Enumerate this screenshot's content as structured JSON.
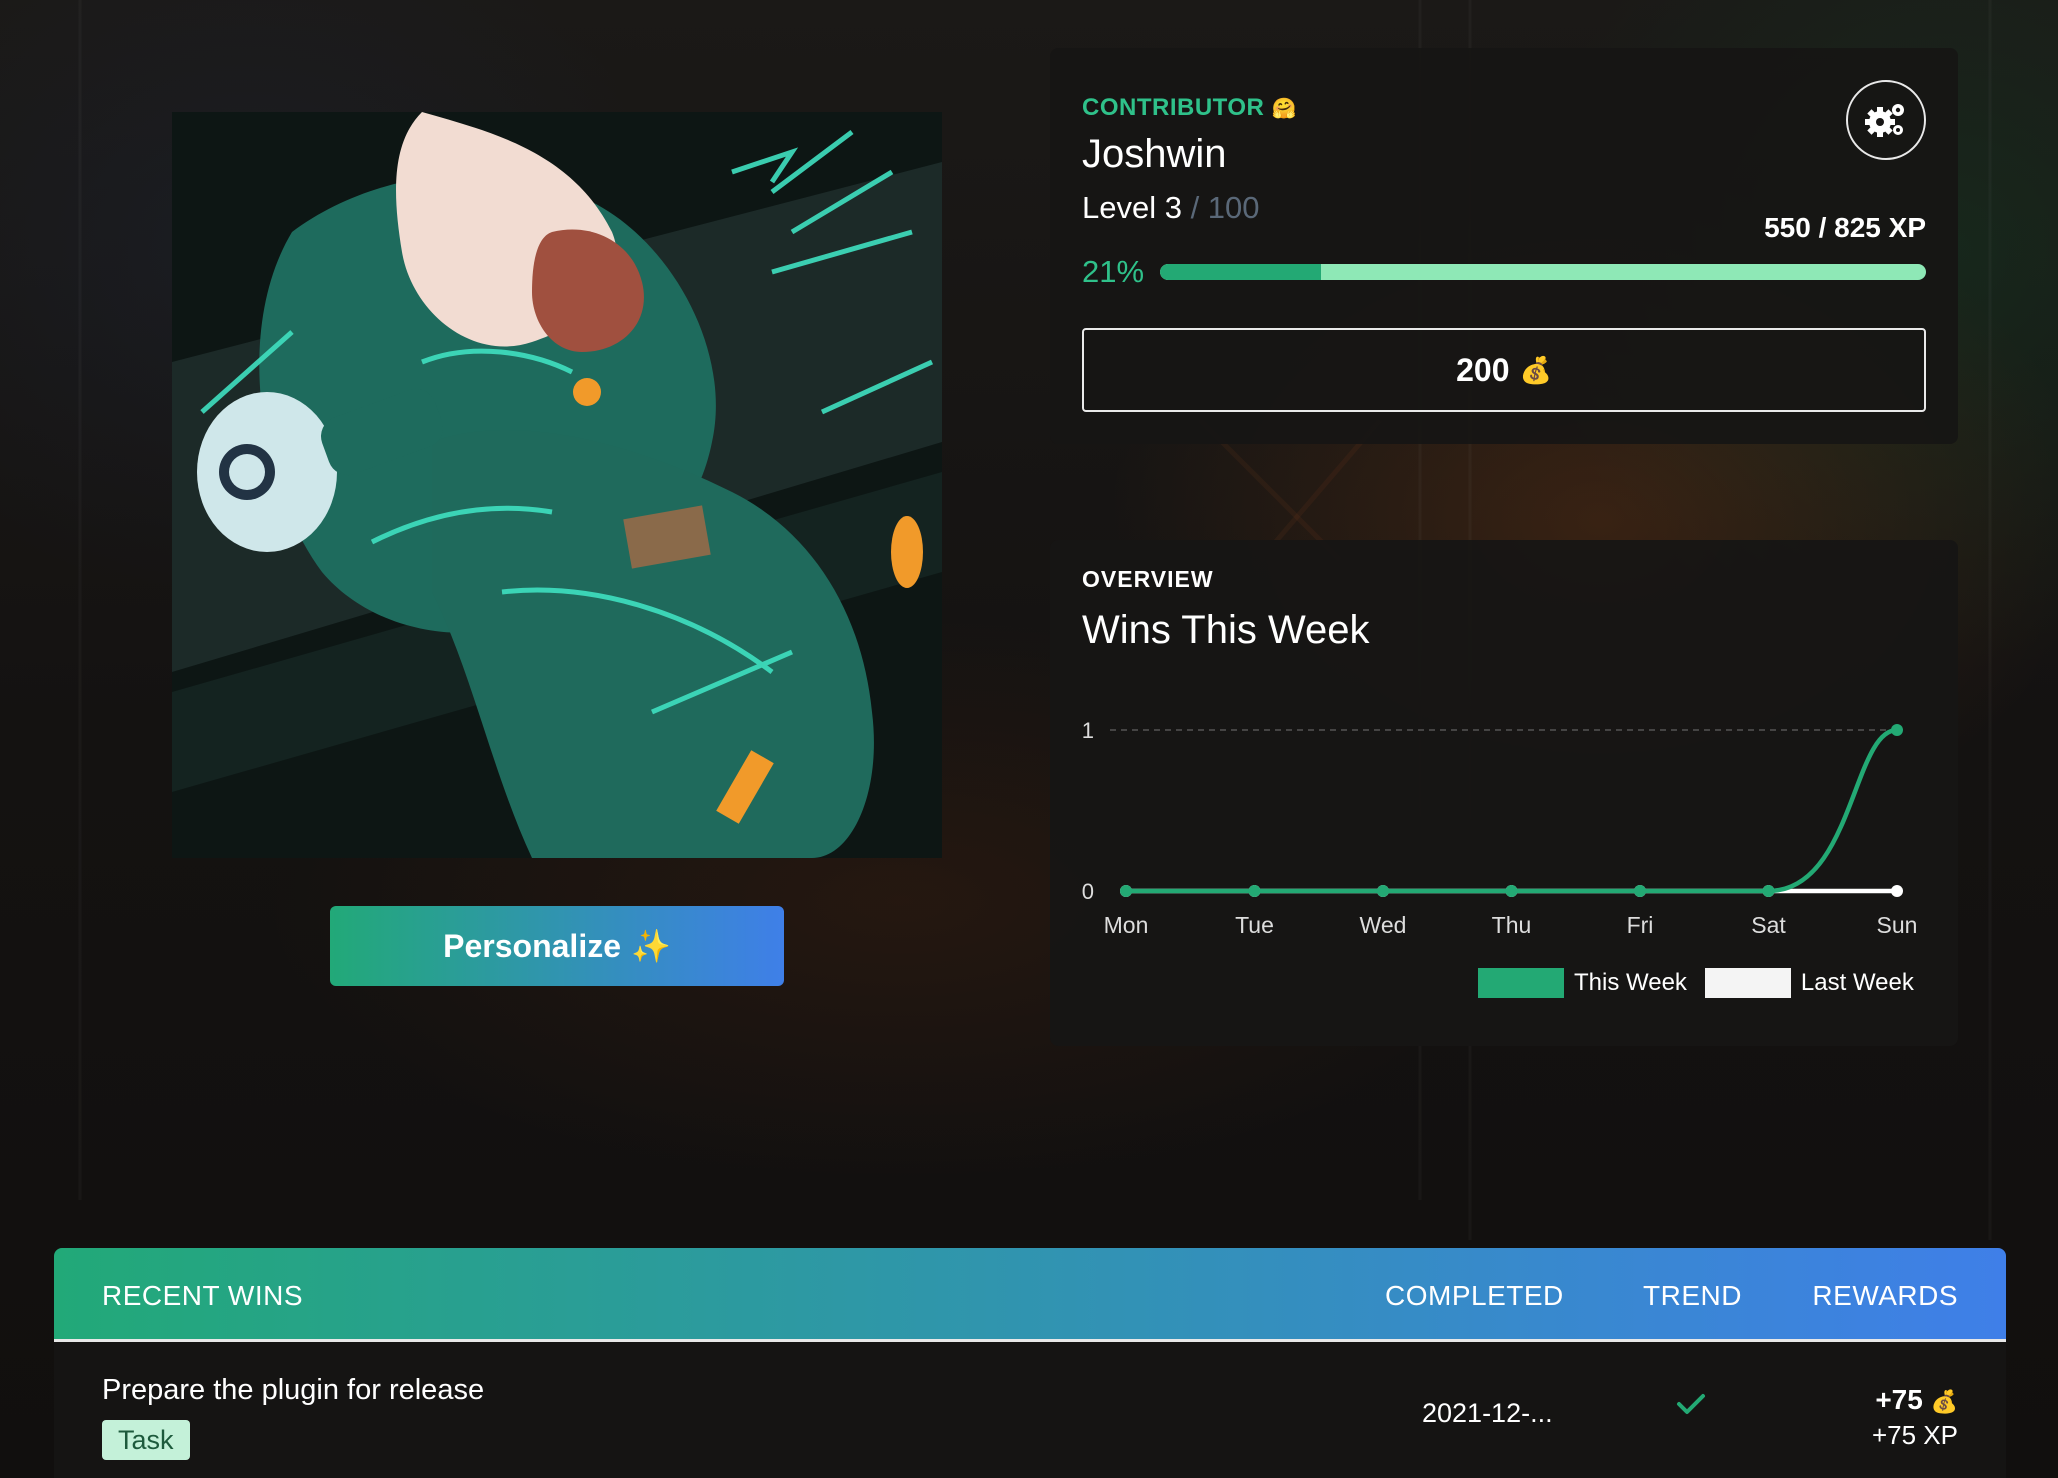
{
  "profile": {
    "role_label": "CONTRIBUTOR",
    "role_emoji": "🤗",
    "username": "Joshwin",
    "level_text": "Level 3",
    "level_max": " / 100",
    "xp_text": "550 / 825 XP",
    "progress_percent_text": "21%",
    "progress_fraction": 0.21,
    "coins_value": "200",
    "coins_icon": "💰",
    "settings_icon": "gears-icon"
  },
  "personalize": {
    "label": "Personalize",
    "icon": "✨"
  },
  "overview": {
    "label": "OVERVIEW",
    "title": "Wins This Week"
  },
  "chart_data": {
    "type": "line",
    "categories": [
      "Mon",
      "Tue",
      "Wed",
      "Thu",
      "Fri",
      "Sat",
      "Sun"
    ],
    "series": [
      {
        "name": "This Week",
        "values": [
          0,
          0,
          0,
          0,
          0,
          0,
          1
        ],
        "color": "#23a974"
      },
      {
        "name": "Last Week",
        "values": [
          0,
          0,
          0,
          0,
          0,
          0,
          0
        ],
        "color": "#ffffff"
      }
    ],
    "ylim": [
      0,
      1
    ],
    "yticks": [
      "0",
      "1"
    ],
    "grid": "dashed line at y=1",
    "legend": "bottom-right"
  },
  "recent_wins": {
    "headers": {
      "title": "RECENT WINS",
      "completed": "COMPLETED",
      "trend": "TREND",
      "rewards": "REWARDS"
    },
    "rows": [
      {
        "title": "Prepare the plugin for release",
        "tag": "Task",
        "completed": "2021-12-...",
        "trend_icon": "check-icon",
        "coins": "+75",
        "coins_icon": "💰",
        "xp": "+75 XP"
      }
    ]
  }
}
